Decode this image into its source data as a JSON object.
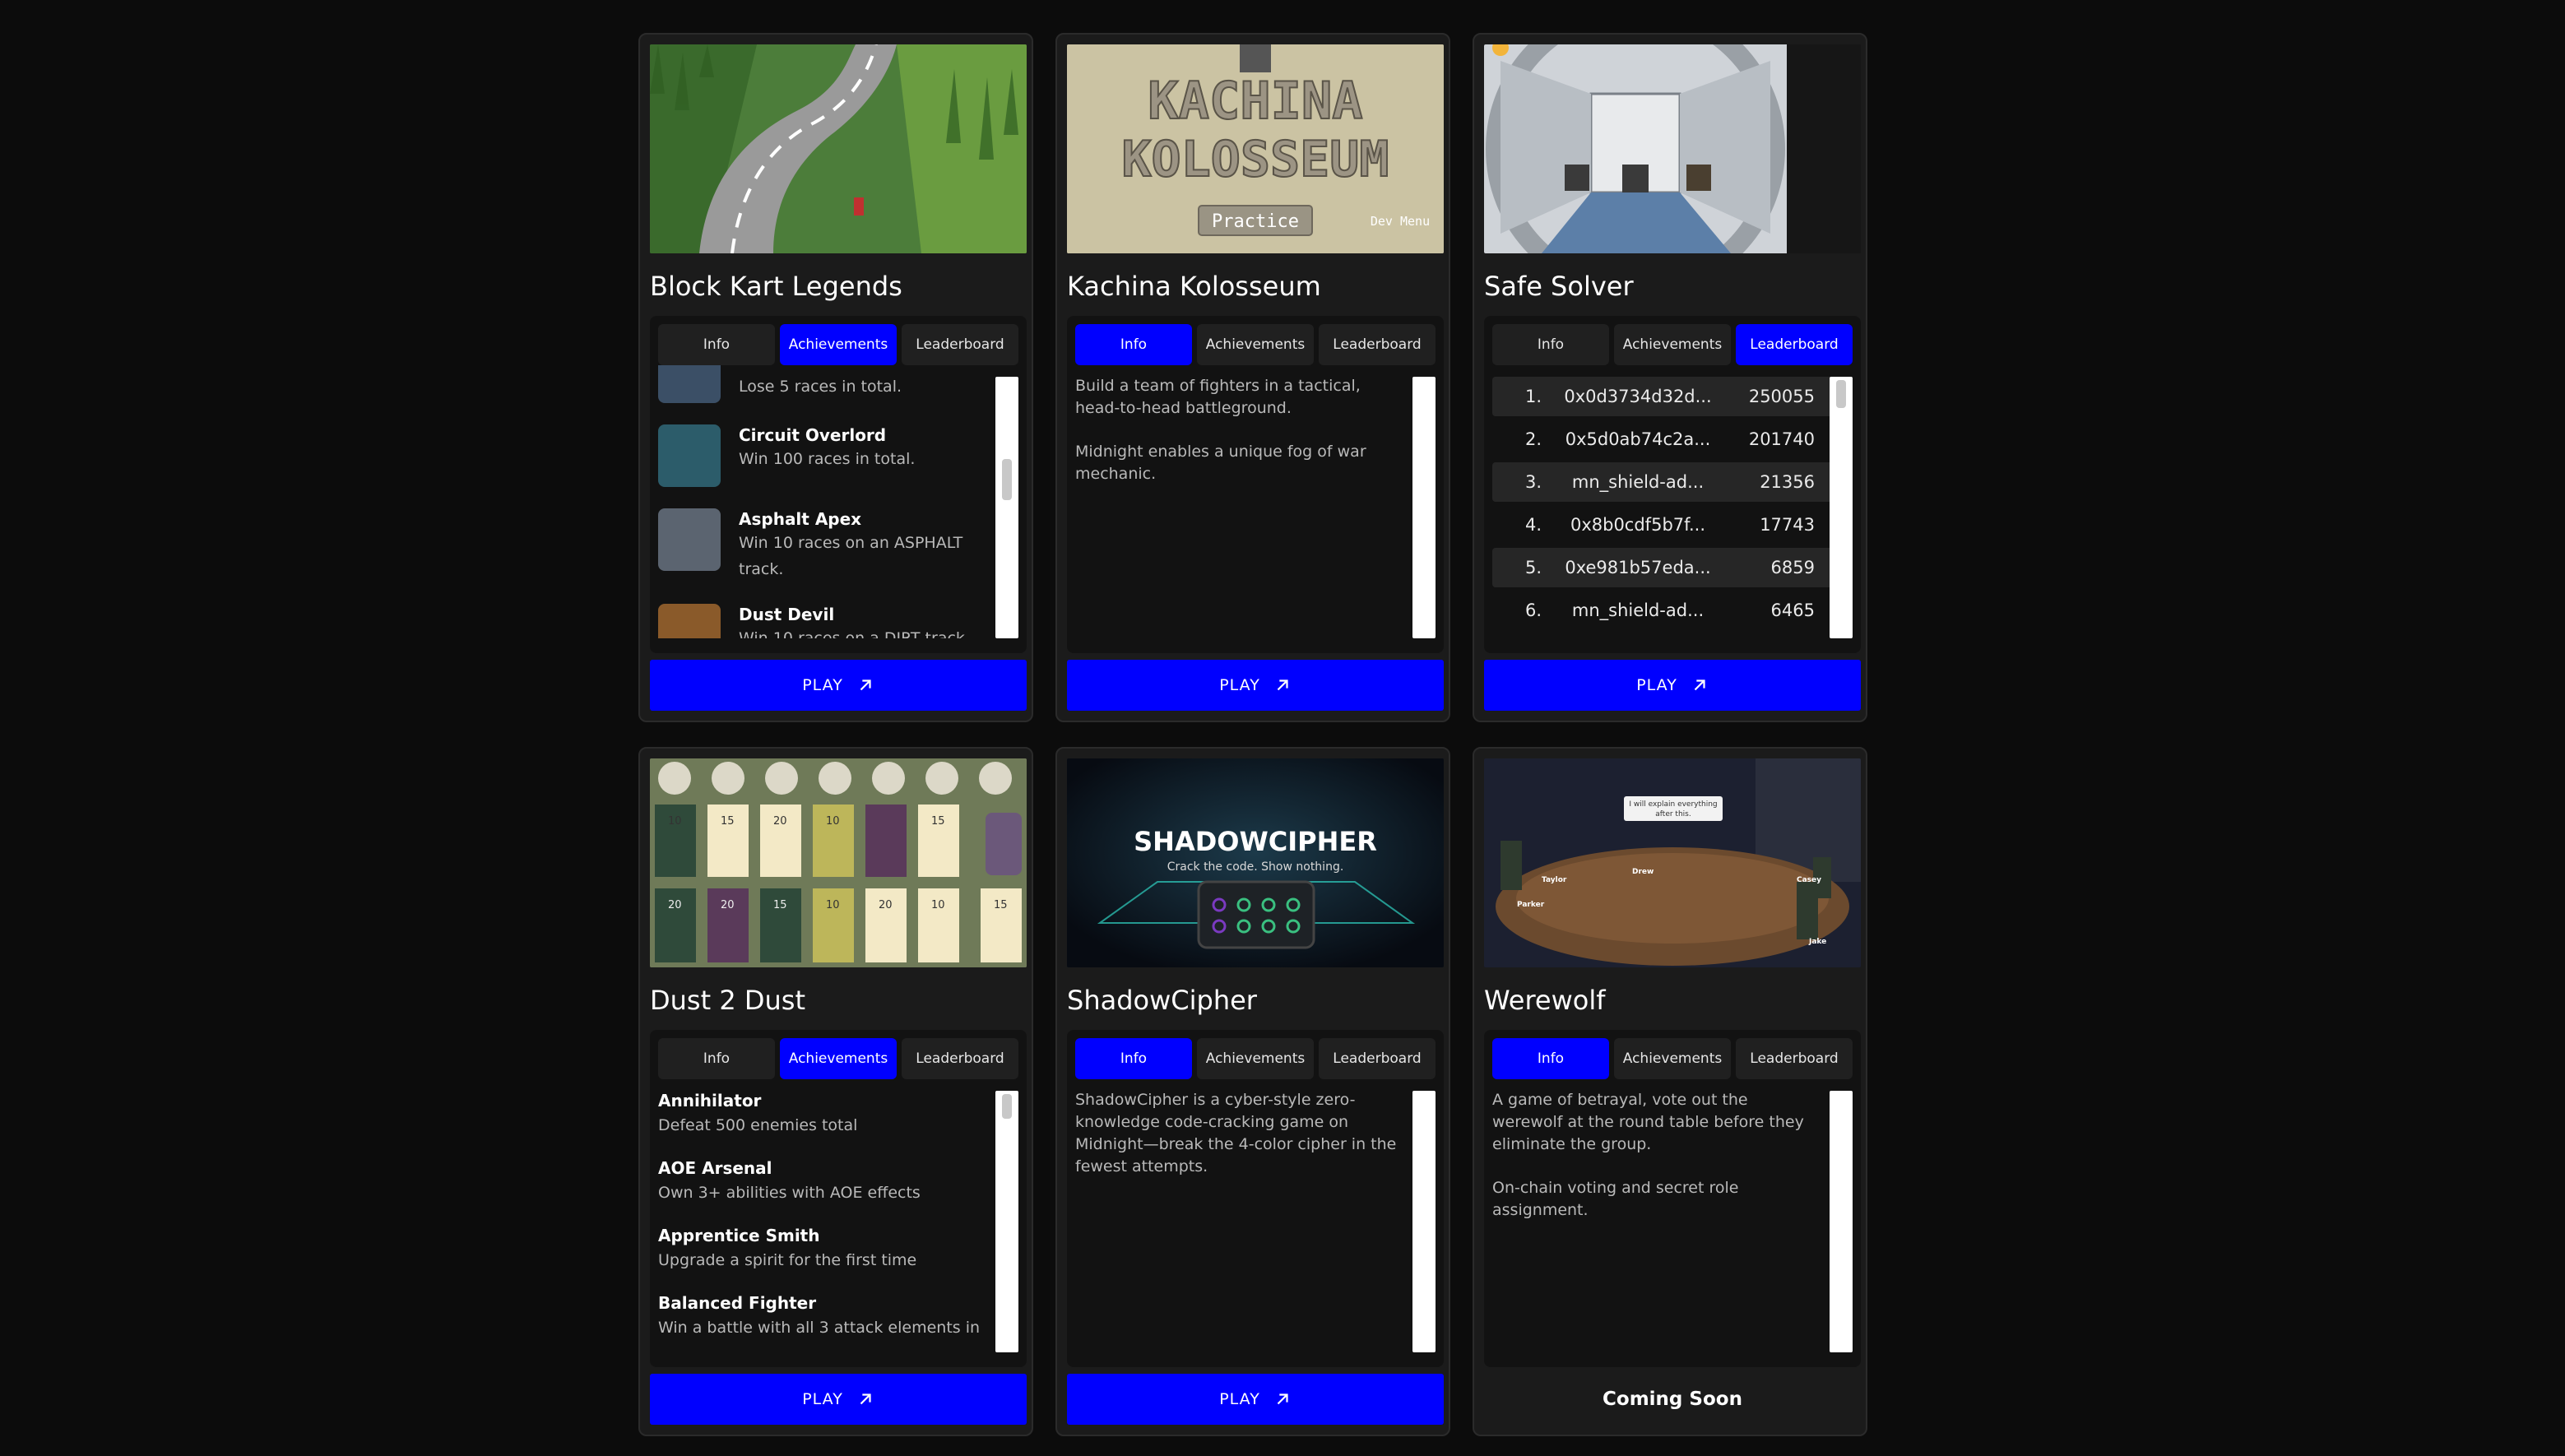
{
  "tabs_labels": {
    "info": "Info",
    "achievements": "Achievements",
    "leaderboard": "Leaderboard"
  },
  "play_label": "PLAY",
  "games": [
    {
      "title": "Block Kart Legends",
      "active_tab": "Achievements",
      "achievements": [
        {
          "name": "",
          "desc": "Lose 5 races in total.",
          "icon": "learning-the-lines-icon"
        },
        {
          "name": "Circuit Overlord",
          "desc": "Win 100 races in total.",
          "icon": "circuit-overlord-icon"
        },
        {
          "name": "Asphalt Apex",
          "desc": "Win 10 races on an ASPHALT track.",
          "icon": "asphalt-apex-icon"
        },
        {
          "name": "Dust Devil",
          "desc": "Win 10 races on a DIRT track.",
          "icon": "dust-devil-icon"
        }
      ]
    },
    {
      "title": "Kachina Kolosseum",
      "active_tab": "Info",
      "thumb_title": "KACHINA KOLOSSEUM",
      "thumb_button": "Practice",
      "thumb_dev": "Dev Menu",
      "info": [
        "Build a team of fighters in a tactical, head-to-head battleground.",
        "Midnight enables a unique fog of war mechanic."
      ]
    },
    {
      "title": "Safe Solver",
      "active_tab": "Leaderboard",
      "leaderboard": [
        {
          "rank": "1.",
          "addr": "0x0d3734d32d...",
          "score": "250055"
        },
        {
          "rank": "2.",
          "addr": "0x5d0ab74c2a...",
          "score": "201740"
        },
        {
          "rank": "3.",
          "addr": "mn_shield-ad...",
          "score": "21356"
        },
        {
          "rank": "4.",
          "addr": "0x8b0cdf5b7f...",
          "score": "17743"
        },
        {
          "rank": "5.",
          "addr": "0xe981b57eda...",
          "score": "6859"
        },
        {
          "rank": "6.",
          "addr": "mn_shield-ad...",
          "score": "6465"
        }
      ]
    },
    {
      "title": "Dust 2 Dust",
      "active_tab": "Achievements",
      "thumb_cards_top": [
        "10",
        "15",
        "20",
        "10",
        "",
        "15"
      ],
      "thumb_cards_bottom": [
        "20",
        "20",
        "15",
        "10",
        "20",
        "10",
        "15"
      ],
      "achievements": [
        {
          "name": "Annihilator",
          "desc": "Defeat 500 enemies total"
        },
        {
          "name": "AOE Arsenal",
          "desc": "Own 3+ abilities with AOE effects"
        },
        {
          "name": "Apprentice Smith",
          "desc": "Upgrade a spirit for the first time"
        },
        {
          "name": "Balanced Fighter",
          "desc": "Win a battle with all 3 attack elements in"
        }
      ]
    },
    {
      "title": "ShadowCipher",
      "active_tab": "Info",
      "thumb_title": "SHADOWCIPHER",
      "thumb_subtitle": "Crack the code. Show nothing.",
      "info": [
        "ShadowCipher is a cyber-style zero-knowledge code-cracking game on Midnight—break the 4-color cipher in the fewest attempts."
      ]
    },
    {
      "title": "Werewolf",
      "active_tab": "Info",
      "thumb_bubble": "I will explain everything after this.",
      "thumb_names": [
        "Parker",
        "Taylor",
        "Drew",
        "Casey",
        "Jake"
      ],
      "info": [
        "A game of betrayal, vote out the werewolf at the round table before they eliminate the group.",
        "On-chain voting and secret role assignment."
      ],
      "coming_soon": "Coming Soon"
    }
  ],
  "colors": {
    "accent": "#0000ff",
    "card": "#1b1b1b",
    "panel": "#121212",
    "bg": "#0c0c0c"
  }
}
